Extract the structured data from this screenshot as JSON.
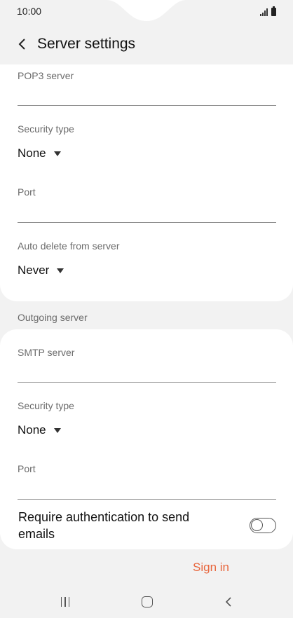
{
  "status_bar": {
    "time": "10:00"
  },
  "app_bar": {
    "title": "Server settings"
  },
  "incoming": {
    "pop3_server_label": "POP3 server",
    "pop3_server_value": "",
    "security_type_label": "Security type",
    "security_type_value": "None",
    "port_label": "Port",
    "port_value": "",
    "auto_delete_label": "Auto delete from server",
    "auto_delete_value": "Never"
  },
  "outgoing": {
    "section_title": "Outgoing server",
    "smtp_server_label": "SMTP server",
    "smtp_server_value": "",
    "security_type_label": "Security type",
    "security_type_value": "None",
    "port_label": "Port",
    "port_value": "",
    "require_auth_label": "Require authentication to send emails",
    "require_auth_enabled": false
  },
  "actions": {
    "sign_in_label": "Sign in"
  },
  "colors": {
    "accent": "#e8663d",
    "background": "#f2f2f2",
    "card": "#ffffff"
  },
  "icons": {
    "back": "chevron-left-icon",
    "dropdown": "caret-down-icon",
    "nav_recents": "recents-icon",
    "nav_home": "home-icon",
    "nav_back": "back-icon"
  }
}
